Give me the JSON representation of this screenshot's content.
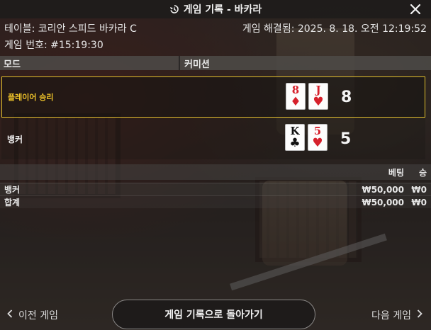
{
  "header": {
    "title": "게임 기록 - 바카라",
    "history_icon": "history-icon",
    "close_icon": "close-icon"
  },
  "info": {
    "table": "테이블: 코리안 스피드 바카라 C",
    "resolved": "게임 해결됨: 2025. 8. 18. 오전 12:19:52",
    "game_no": "게임 번호: #15:19:30"
  },
  "section": {
    "mode_label": "모드",
    "mode_value": "커미션"
  },
  "results": {
    "player": {
      "label": "플레이어 승리",
      "cards": [
        {
          "rank": "8",
          "suit": "♦",
          "color": "red"
        },
        {
          "rank": "J",
          "suit": "♥",
          "color": "red"
        }
      ],
      "score": "8"
    },
    "banker": {
      "label": "뱅커",
      "cards": [
        {
          "rank": "K",
          "suit": "♣",
          "color": "black"
        },
        {
          "rank": "5",
          "suit": "♥",
          "color": "red"
        }
      ],
      "score": "5"
    }
  },
  "bets": {
    "headers": {
      "bet": "베팅",
      "win": "승"
    },
    "rows": [
      {
        "name": "뱅커",
        "amount": "₩50,000",
        "win": "₩0"
      },
      {
        "name": "합계",
        "amount": "₩50,000",
        "win": "₩0"
      }
    ]
  },
  "footer": {
    "prev": "이전 게임",
    "back": "게임 기록으로 돌아가기",
    "next": "다음 게임"
  },
  "colors": {
    "highlight": "#e1bf2c",
    "card_red": "#d6202b",
    "card_black": "#111111"
  }
}
